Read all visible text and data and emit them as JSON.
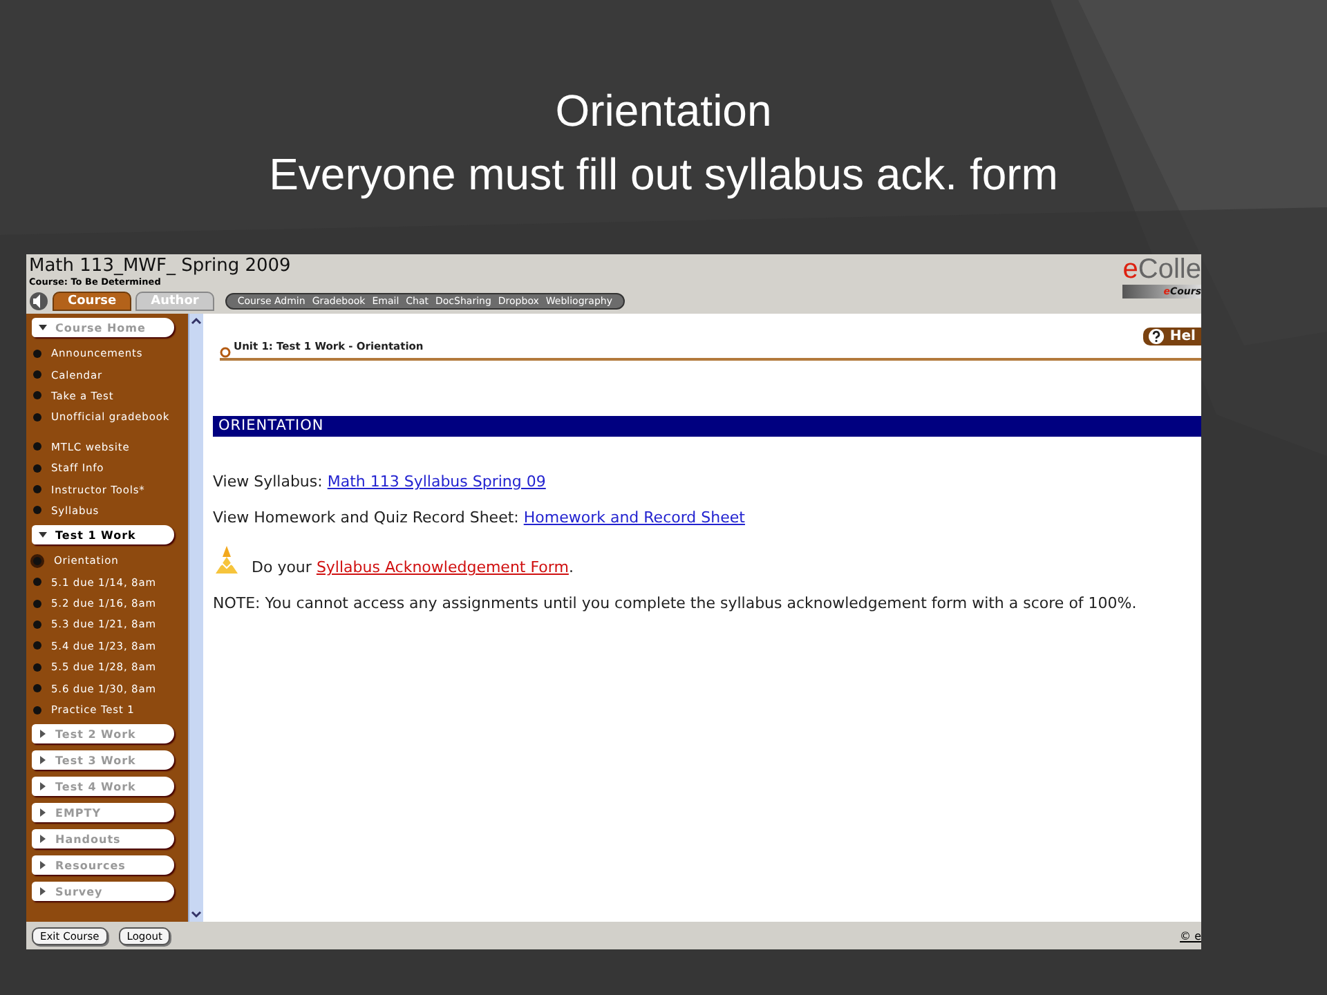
{
  "slide": {
    "title_lines": [
      "Orientation",
      "Everyone must fill out syllabus ack. form"
    ]
  },
  "header": {
    "course_title": "Math 113_MWF_ Spring 2009",
    "course_subtitle": "Course: To Be Determined",
    "tabs": [
      {
        "label": "Course",
        "selected": true
      },
      {
        "label": "Author",
        "selected": false
      }
    ],
    "toolbar_links": [
      "Course Admin",
      "Gradebook",
      "Email",
      "Chat",
      "DocSharing",
      "Dropbox",
      "Webliography"
    ],
    "logo": {
      "accent": "e",
      "rest": "Colle"
    },
    "logo_sub": {
      "accent": "e",
      "rest": "Cours"
    }
  },
  "sidebar": {
    "sections": [
      {
        "label": "Course Home",
        "expanded": true,
        "active": false,
        "items": [
          {
            "label": "Announcements",
            "selected": false
          },
          {
            "label": "Calendar",
            "selected": false
          },
          {
            "label": "Take a Test",
            "selected": false
          },
          {
            "label": "Unofficial gradebook",
            "selected": false
          },
          {
            "label": "MTLC website",
            "selected": false
          },
          {
            "label": "Staff Info",
            "selected": false
          },
          {
            "label": "Instructor Tools*",
            "selected": false
          },
          {
            "label": "Syllabus",
            "selected": false
          }
        ]
      },
      {
        "label": "Test 1 Work",
        "expanded": true,
        "active": true,
        "items": [
          {
            "label": "Orientation",
            "selected": true
          },
          {
            "label": "5.1 due 1/14, 8am",
            "selected": false
          },
          {
            "label": "5.2 due 1/16, 8am",
            "selected": false
          },
          {
            "label": "5.3 due 1/21, 8am",
            "selected": false
          },
          {
            "label": "5.4 due 1/23, 8am",
            "selected": false
          },
          {
            "label": "5.5 due 1/28, 8am",
            "selected": false
          },
          {
            "label": "5.6 due 1/30, 8am",
            "selected": false
          },
          {
            "label": "Practice Test 1",
            "selected": false
          }
        ]
      },
      {
        "label": "Test 2 Work",
        "expanded": false,
        "active": false
      },
      {
        "label": "Test 3 Work",
        "expanded": false,
        "active": false
      },
      {
        "label": "Test 4 Work",
        "expanded": false,
        "active": false
      },
      {
        "label": "EMPTY",
        "expanded": false,
        "active": false
      },
      {
        "label": "Handouts",
        "expanded": false,
        "active": false
      },
      {
        "label": "Resources",
        "expanded": false,
        "active": false
      },
      {
        "label": "Survey",
        "expanded": false,
        "active": false
      }
    ]
  },
  "content": {
    "breadcrumb": "Unit 1: Test 1 Work - Orientation",
    "help_button": "Hel",
    "heading": "ORIENTATION",
    "lines": [
      {
        "kind": "link",
        "label": "View Syllabus: ",
        "link": "Math 113 Syllabus Spring 09"
      },
      {
        "kind": "link",
        "label": "View Homework and Quiz Record Sheet: ",
        "link": "Homework and Record Sheet"
      },
      {
        "kind": "task",
        "label": "Do your ",
        "link": " Syllabus Acknowledgement Form",
        "after": "."
      },
      {
        "kind": "note",
        "text": "NOTE: You cannot access any assignments until you complete the syllabus acknowledgement form with a score of 100%."
      }
    ]
  },
  "footer": {
    "buttons": [
      "Exit Course",
      "Logout"
    ],
    "copyright": "© e"
  }
}
